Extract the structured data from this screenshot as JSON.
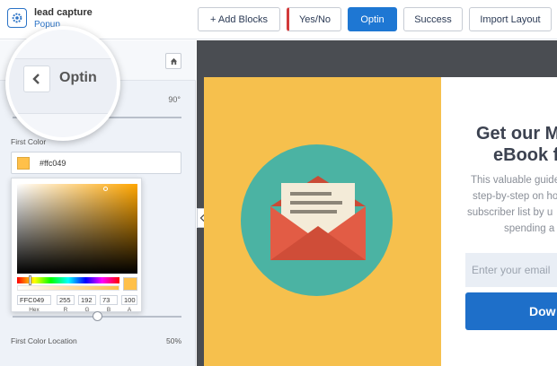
{
  "app": {
    "title": "lead capture",
    "subtitle": "Popup",
    "logo_icon": "gear-icon"
  },
  "toolbar": {
    "buttons": [
      {
        "label": "+ Add Blocks",
        "active": false
      },
      {
        "label": "Yes/No",
        "active": false
      },
      {
        "label": "Optin",
        "active": true
      },
      {
        "label": "Success",
        "active": false
      },
      {
        "label": "Import Layout",
        "active": false
      }
    ]
  },
  "sidebar": {
    "breadcrumb_label": "Optin",
    "home_icon": "home-icon",
    "angle_value": "90°",
    "first_color_label": "First Color",
    "first_color_value": "#ffc049",
    "picker": {
      "hex": "FFC049",
      "r": "255",
      "g": "192",
      "b": "73",
      "a": "100",
      "labels": {
        "hex": "Hex",
        "r": "R",
        "g": "G",
        "b": "B",
        "a": "A"
      }
    },
    "location_label": "First Color Location",
    "location_value": "50%",
    "location_fraction": 0.5
  },
  "canvas": {
    "headline_line1": "Get our M",
    "headline_line2": "eBook f",
    "body_lines": [
      "This valuable guide",
      "step-by-step on ho",
      "subscriber list by u",
      "spending a s"
    ],
    "email_placeholder": "Enter your email",
    "button_label": "Dow"
  },
  "colors": {
    "accent": "#1e77d3",
    "selected_color": "#ffc049",
    "panel_yellow": "#f6c04d",
    "circle_teal": "#4bb3a3",
    "envelope_red": "#e25c45"
  }
}
